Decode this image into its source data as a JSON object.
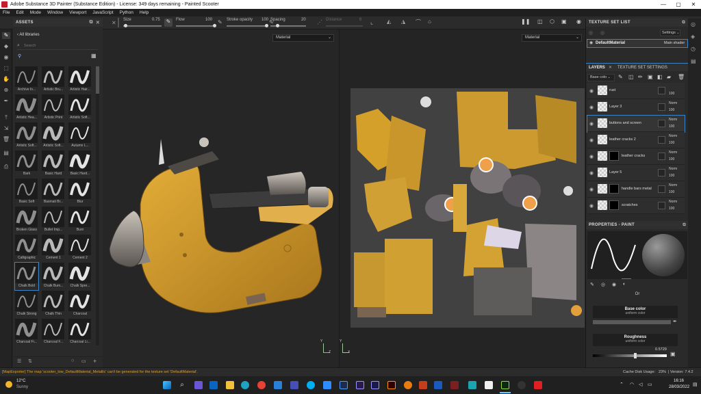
{
  "window": {
    "title": "Adobe Substance 3D Painter (Substance Edition) - License: 349 days remaining - Painted Scooter",
    "controls": [
      "—",
      "▢",
      "✕"
    ]
  },
  "menu": [
    "File",
    "Edit",
    "Mode",
    "Window",
    "Viewport",
    "JavaScript",
    "Python",
    "Help"
  ],
  "toolbar": {
    "size_label": "Size",
    "size_value": "0.75",
    "flow_label": "Flow",
    "flow_value": "100",
    "stroke_label": "Stroke opacity",
    "stroke_value": "100",
    "spacing_label": "Spacing",
    "spacing_value": "20",
    "distance_label": "Distance",
    "distance_value": "6",
    "size_fraction": 0.05,
    "flow_fraction": 1.0,
    "stroke_fraction": 1.0,
    "spacing_fraction": 0.2
  },
  "assets": {
    "title": "ASSETS",
    "nav": "All libraries",
    "search_placeholder": "Search",
    "brushes": [
      "Archive In...",
      "Artistic Bru...",
      "Artistic Hair...",
      "Artistic Hea...",
      "Artistic Print",
      "Artistic Soft...",
      "Artistic Soft...",
      "Artistic Soft...",
      "Autumn L...",
      "Bark",
      "Basic Hard",
      "Basic Hard...",
      "Basic Soft",
      "Basmati Br...",
      "Blur",
      "Broken Glass",
      "Bullet Imp...",
      "Burn",
      "Calligraphic",
      "Cement 1",
      "Cement 2",
      "Chalk Bold",
      "Chalk Bum...",
      "Chalk Spre...",
      "Chalk Strong",
      "Chalk Thin",
      "Charcoal",
      "Charcoal Fi...",
      "Charcoal F...",
      "Charcoal Li..."
    ],
    "selected_index": 21
  },
  "viewport": {
    "left_mode": "Material",
    "right_mode": "Material",
    "axis_x": "Z",
    "axis_y": "Y",
    "axis_x2": "X",
    "axis_y2": "Y"
  },
  "texture_set_list": {
    "title": "TEXTURE SET LIST",
    "settings": "Settings",
    "item": "DefaultMaterial",
    "shader": "Main shader"
  },
  "layers_tabs": {
    "layers": "LAYERS",
    "tss": "TEXTURE SET SETTINGS",
    "channel": "Base colo"
  },
  "layers": [
    {
      "name": "rust",
      "blend": "",
      "opacity": "100",
      "mask": false
    },
    {
      "name": "Layer 3",
      "blend": "Norm",
      "opacity": "100",
      "mask": false
    },
    {
      "name": "buttons and screen",
      "blend": "Norm",
      "opacity": "100",
      "mask": false
    },
    {
      "name": "leather cracks 2",
      "blend": "Norm",
      "opacity": "100",
      "mask": false
    },
    {
      "name": "leather cracks",
      "blend": "Norm",
      "opacity": "100",
      "mask": true
    },
    {
      "name": "Layer 5",
      "blend": "Norm",
      "opacity": "100",
      "mask": false
    },
    {
      "name": "handle bars metal",
      "blend": "Norm",
      "opacity": "100",
      "mask": true
    },
    {
      "name": "scratches",
      "blend": "Norm",
      "opacity": "100",
      "mask": true
    }
  ],
  "properties": {
    "title": "PROPERTIES - PAINT",
    "or": "Or",
    "base_color": "Base color",
    "base_sub": "uniform color",
    "roughness": "Roughness",
    "rough_sub": "uniform color",
    "rough_value": "0.5729",
    "rough_fraction": 0.5729
  },
  "status": {
    "message": "[MapExporter] The map 'scooter_low_DefaultMaterial_Metallic' can't be generated for the texture set 'DefaultMaterial'.",
    "cache": "Cache Disk Usage:",
    "cache_pct": "23%",
    "version": "| Version: 7.4.2"
  },
  "taskbar": {
    "temp": "12°C",
    "weather": "Sunny",
    "time": "16:16",
    "date": "28/03/2022"
  },
  "colors": {
    "accent": "#3c84c4",
    "error": "#e0a030",
    "scooter": "#d9a22b"
  }
}
